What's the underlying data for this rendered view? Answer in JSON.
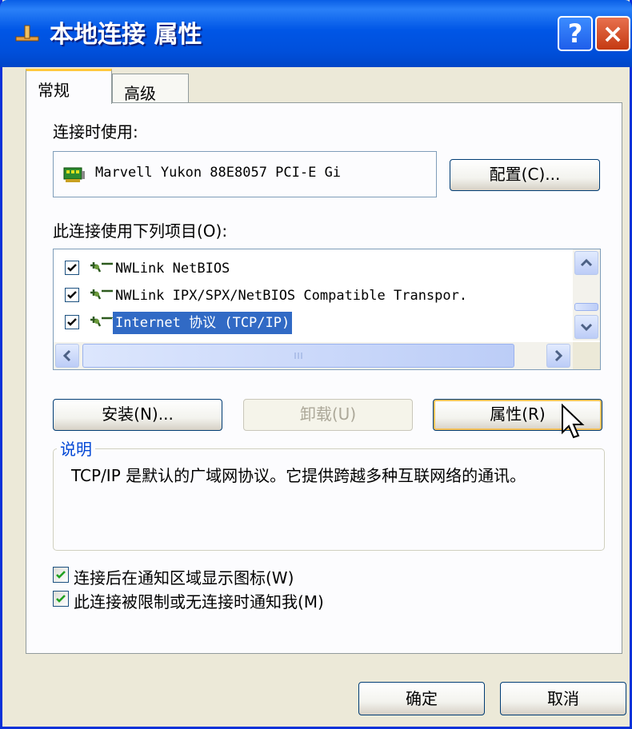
{
  "window": {
    "title": "本地连接 属性",
    "help_glyph": "?",
    "close_glyph": "×"
  },
  "tabs": [
    {
      "label": "常规",
      "active": true
    },
    {
      "label": "高级",
      "active": false
    }
  ],
  "general": {
    "connect_using_label": "连接时使用:",
    "adapter_name": "Marvell Yukon 88E8057 PCI-E Gi",
    "configure_button": "配置(C)...",
    "items_label": "此连接使用下列项目(O):",
    "items": [
      {
        "label": "NWLink NetBIOS",
        "checked": true,
        "selected": false
      },
      {
        "label": "NWLink IPX/SPX/NetBIOS Compatible Transpor.",
        "checked": true,
        "selected": false
      },
      {
        "label": "Internet 协议 (TCP/IP)",
        "checked": true,
        "selected": true
      }
    ],
    "install_button": "安装(N)...",
    "uninstall_button": "卸载(U)",
    "properties_button": "属性(R)",
    "description_legend": "说明",
    "description_text": "TCP/IP 是默认的广域网协议。它提供跨越多种互联网络的通讯。",
    "show_icon_option": {
      "label": "连接后在通知区域显示图标(W)",
      "checked": true
    },
    "notify_option": {
      "label": "此连接被限制或无连接时通知我(M)",
      "checked": true
    }
  },
  "footer": {
    "ok_button": "确定",
    "cancel_button": "取消"
  },
  "colors": {
    "title_bar": "#0054E3",
    "selection": "#316AC5",
    "legend": "#0046D5",
    "dialog_bg": "#ECE9D8"
  }
}
